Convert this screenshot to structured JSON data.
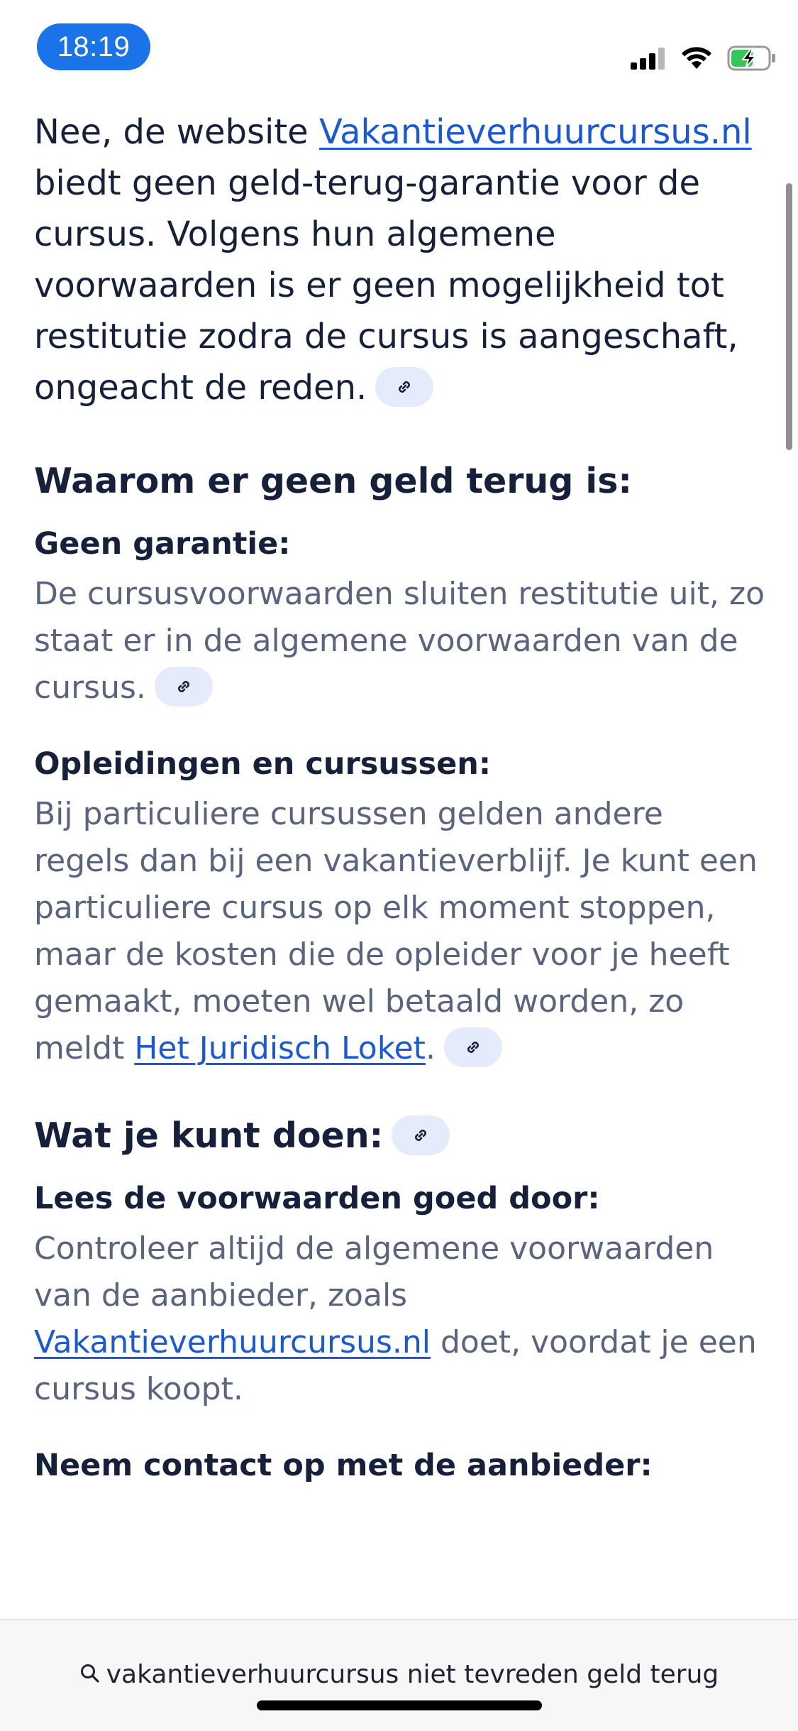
{
  "status_bar": {
    "time": "18:19",
    "icons": [
      "cellular-signal-icon",
      "wifi-icon",
      "battery-charging-icon"
    ]
  },
  "answer": {
    "intro_prefix": "Nee, de website ",
    "intro_link": "Vakantieverhuurcursus.nl",
    "intro_suffix": " biedt geen geld-terug-garantie voor de cursus. Volgens hun algemene voorwaarden is er geen mogelijkheid tot restitutie zodra de cursus is aangeschaft, ongeacht de reden.",
    "section1": {
      "heading": "Waarom er geen geld terug is:",
      "items": [
        {
          "title": "Geen garantie:",
          "text": "De cursusvoorwaarden sluiten restitutie uit, zo staat er in de algemene voorwaarden van de cursus."
        },
        {
          "title": "Opleidingen en cursussen:",
          "text": "Bij particuliere cursussen gelden andere regels dan bij een vakantieverblijf. Je kunt een particuliere cursus op elk moment stoppen, maar de kosten die de opleider voor je heeft gemaakt, moeten wel betaald worden, zo meldt ",
          "link": "Het Juridisch Loket",
          "suffix": "."
        }
      ]
    },
    "section2": {
      "heading": "Wat je kunt doen:",
      "items": [
        {
          "title": "Lees de voorwaarden goed door:",
          "text": "Controleer altijd de algemene voorwaarden van de aanbieder, zoals ",
          "link": "Vakantieverhuurcursus.nl",
          "suffix": " doet, voordat je een cursus koopt."
        },
        {
          "title": "Neem contact op met de aanbieder:"
        }
      ]
    }
  },
  "search_bar": {
    "query": "vakantieverhuurcursus niet tevreden geld terug"
  },
  "colors": {
    "time_pill": "#1a73e8",
    "link": "#1a59d6",
    "chip_bg": "#e6ebfb",
    "heading_text": "#16203a",
    "muted_text": "#5b647e",
    "battery_charging": "#34c759"
  }
}
